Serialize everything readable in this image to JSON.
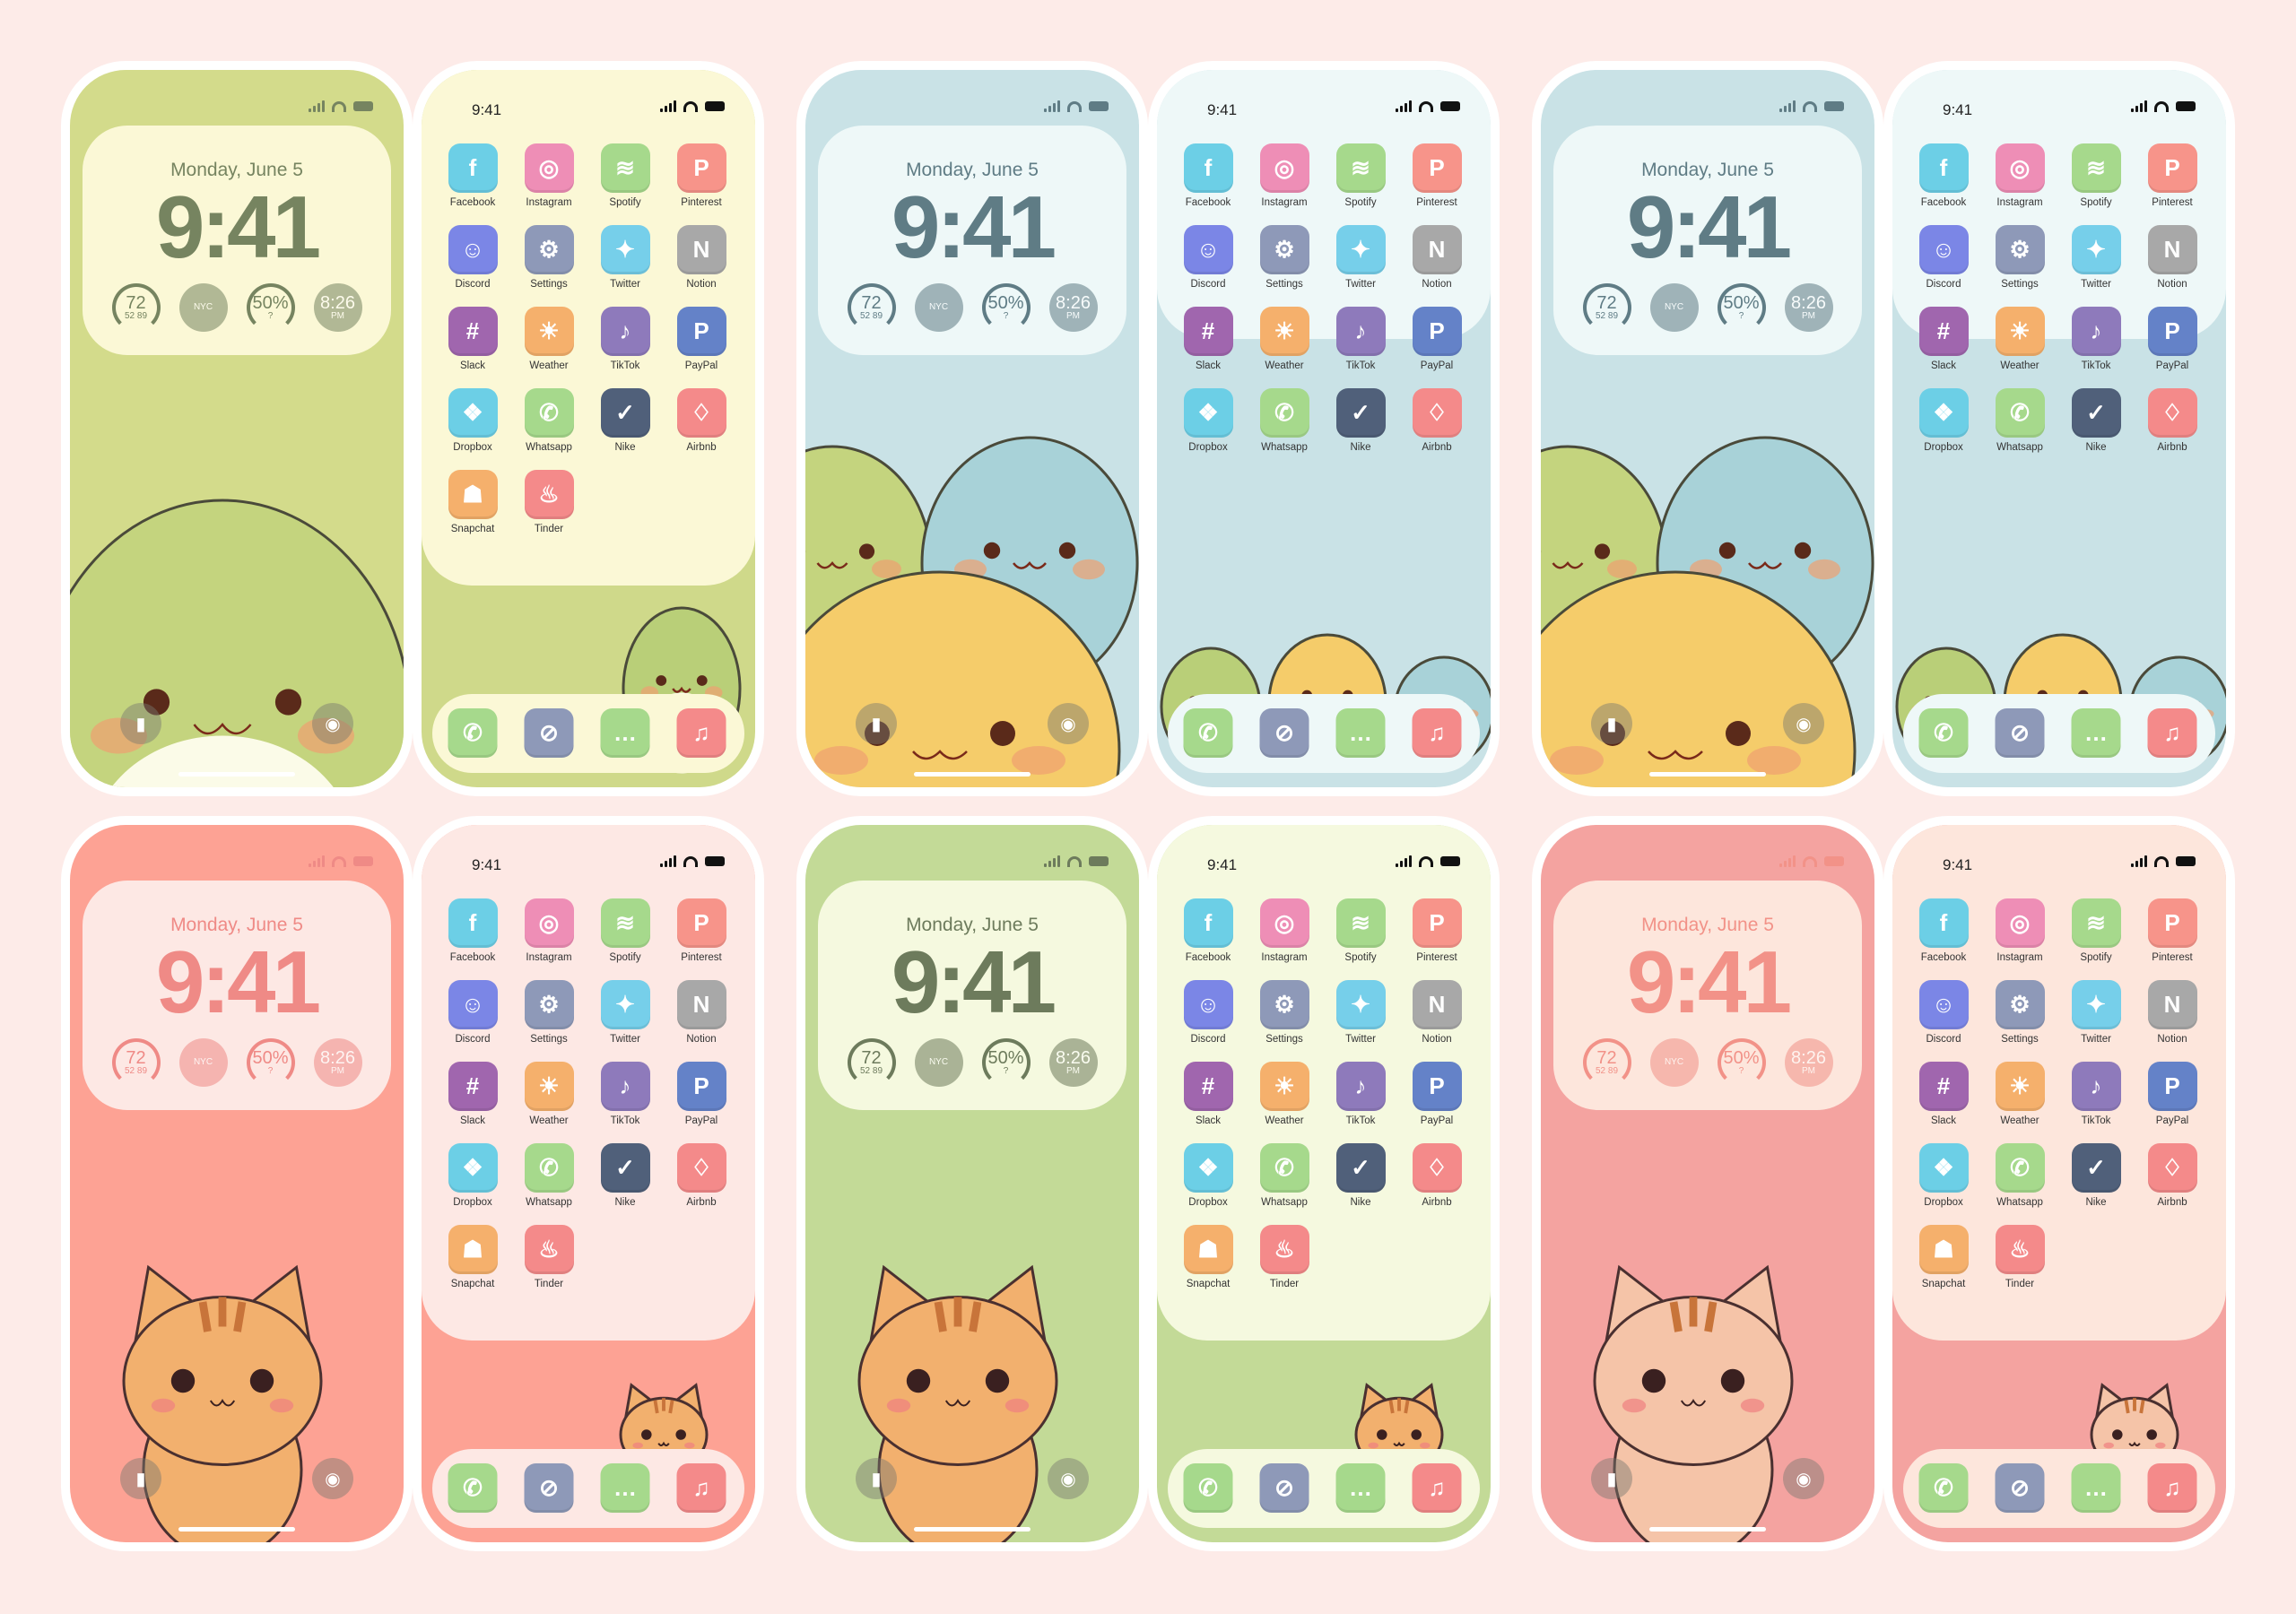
{
  "lock": {
    "date": "Monday, June 5",
    "time": "9:41",
    "weather_temp": "72",
    "weather_range": "52  89",
    "clock_city": "NYC",
    "battery": "50%",
    "battery_icon": "?",
    "alarm_time": "8:26",
    "alarm_ampm": "PM"
  },
  "home": {
    "time": "9:41",
    "apps": [
      {
        "label": "Facebook",
        "icon": "facebook-icon",
        "glyph": "f",
        "color": "#6ccfe6"
      },
      {
        "label": "Instagram",
        "icon": "instagram-icon",
        "glyph": "◎",
        "color": "#ee8eb6"
      },
      {
        "label": "Spotify",
        "icon": "spotify-icon",
        "glyph": "≋",
        "color": "#a6d98c"
      },
      {
        "label": "Pinterest",
        "icon": "pinterest-icon",
        "glyph": "P",
        "color": "#f7948a"
      },
      {
        "label": "Discord",
        "icon": "discord-icon",
        "glyph": "☺",
        "color": "#7b86e6"
      },
      {
        "label": "Settings",
        "icon": "gear-icon",
        "glyph": "⚙",
        "color": "#8e99b8"
      },
      {
        "label": "Twitter",
        "icon": "twitter-bird-icon",
        "glyph": "✦",
        "color": "#76cfea"
      },
      {
        "label": "Notion",
        "icon": "notion-icon",
        "glyph": "N",
        "color": "#a8a8a8"
      },
      {
        "label": "Slack",
        "icon": "slack-icon",
        "glyph": "#",
        "color": "#a066ae"
      },
      {
        "label": "Weather",
        "icon": "sun-icon",
        "glyph": "☀",
        "color": "#f5b06c"
      },
      {
        "label": "TikTok",
        "icon": "tiktok-icon",
        "glyph": "♪",
        "color": "#8e7abb"
      },
      {
        "label": "PayPal",
        "icon": "paypal-icon",
        "glyph": "P",
        "color": "#6482c8"
      },
      {
        "label": "Dropbox",
        "icon": "dropbox-icon",
        "glyph": "❖",
        "color": "#6ccfe6"
      },
      {
        "label": "Whatsapp",
        "icon": "whatsapp-icon",
        "glyph": "✆",
        "color": "#a6d98c"
      },
      {
        "label": "Nike",
        "icon": "nike-swoosh-icon",
        "glyph": "✓",
        "color": "#50607a"
      },
      {
        "label": "Airbnb",
        "icon": "airbnb-icon",
        "glyph": "♢",
        "color": "#f48a8a"
      },
      {
        "label": "Snapchat",
        "icon": "snapchat-ghost-icon",
        "glyph": "☗",
        "color": "#f5b06c"
      },
      {
        "label": "Tinder",
        "icon": "flame-icon",
        "glyph": "♨",
        "color": "#f48a8a"
      }
    ],
    "dock": [
      {
        "icon": "phone-icon",
        "glyph": "✆",
        "color": "#a6d98c"
      },
      {
        "icon": "compass-icon",
        "glyph": "⊘",
        "color": "#8e99b8"
      },
      {
        "icon": "message-bubble-icon",
        "glyph": "…",
        "color": "#a6d98c"
      },
      {
        "icon": "music-note-icon",
        "glyph": "♫",
        "color": "#f48a8a"
      }
    ]
  },
  "themes": [
    {
      "name": "green-dino",
      "lock_bg": "#d3db8b",
      "card": "#fbf8d6",
      "text": "#768460",
      "panel": "#fbf8d6",
      "home_bg": "#cfd98a",
      "dock": "#fbf8d6",
      "app_rows": 5,
      "art": "dino"
    },
    {
      "name": "blue-trio",
      "lock_bg": "#c9e2e6",
      "card": "#eef8f8",
      "text": "#5f7c85",
      "panel": "#eef8f8",
      "home_bg": "#c9e2e6",
      "dock": "#eef8f8",
      "app_rows": 4,
      "art": "trio"
    },
    {
      "name": "blue-trio-2",
      "lock_bg": "#c9e2e6",
      "card": "#eef8f8",
      "text": "#5f7c85",
      "panel": "#eef8f8",
      "home_bg": "#c9e2e6",
      "dock": "#eef8f8",
      "app_rows": 4,
      "art": "trio"
    },
    {
      "name": "salmon-cat",
      "lock_bg": "#fda294",
      "card": "#fde8e4",
      "text": "#ef8a86",
      "panel": "#fde8e4",
      "home_bg": "#fda294",
      "dock": "#fde8e4",
      "app_rows": 5,
      "art": "cat"
    },
    {
      "name": "green-cat",
      "lock_bg": "#c3da97",
      "card": "#f5f9df",
      "text": "#6d7b5c",
      "panel": "#f5f9df",
      "home_bg": "#c3da97",
      "dock": "#f5f9df",
      "app_rows": 5,
      "art": "cat"
    },
    {
      "name": "pink-cat",
      "lock_bg": "#f4a3a0",
      "card": "#fde6dc",
      "text": "#f29288",
      "panel": "#fde6dc",
      "home_bg": "#f4a3a0",
      "dock": "#fde6dc",
      "app_rows": 5,
      "art": "cat2"
    }
  ]
}
